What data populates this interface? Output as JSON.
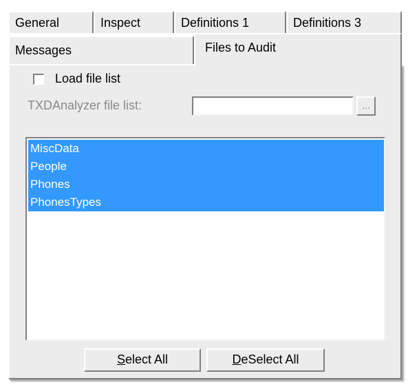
{
  "tabs": {
    "row1": [
      "General",
      "Inspect",
      "Definitions 1",
      "Definitions 3"
    ],
    "row2": [
      "Messages",
      "Files to Audit"
    ]
  },
  "load_file_list": {
    "label": "Load file list",
    "checked": false
  },
  "file_list_field": {
    "label": "TXDAnalyzer file list:",
    "value": "",
    "browse_label": "..."
  },
  "files_list": {
    "items": [
      "MiscData",
      "People",
      "Phones",
      "PhonesTypes"
    ],
    "selected": [
      0,
      1,
      2,
      3
    ]
  },
  "buttons": {
    "select_all": {
      "mnemonic": "S",
      "rest": "elect All"
    },
    "deselect_all": {
      "mnemonic": "D",
      "rest": "eSelect All"
    }
  },
  "colors": {
    "selection": "#3399ff",
    "dialog": "#ececec"
  }
}
